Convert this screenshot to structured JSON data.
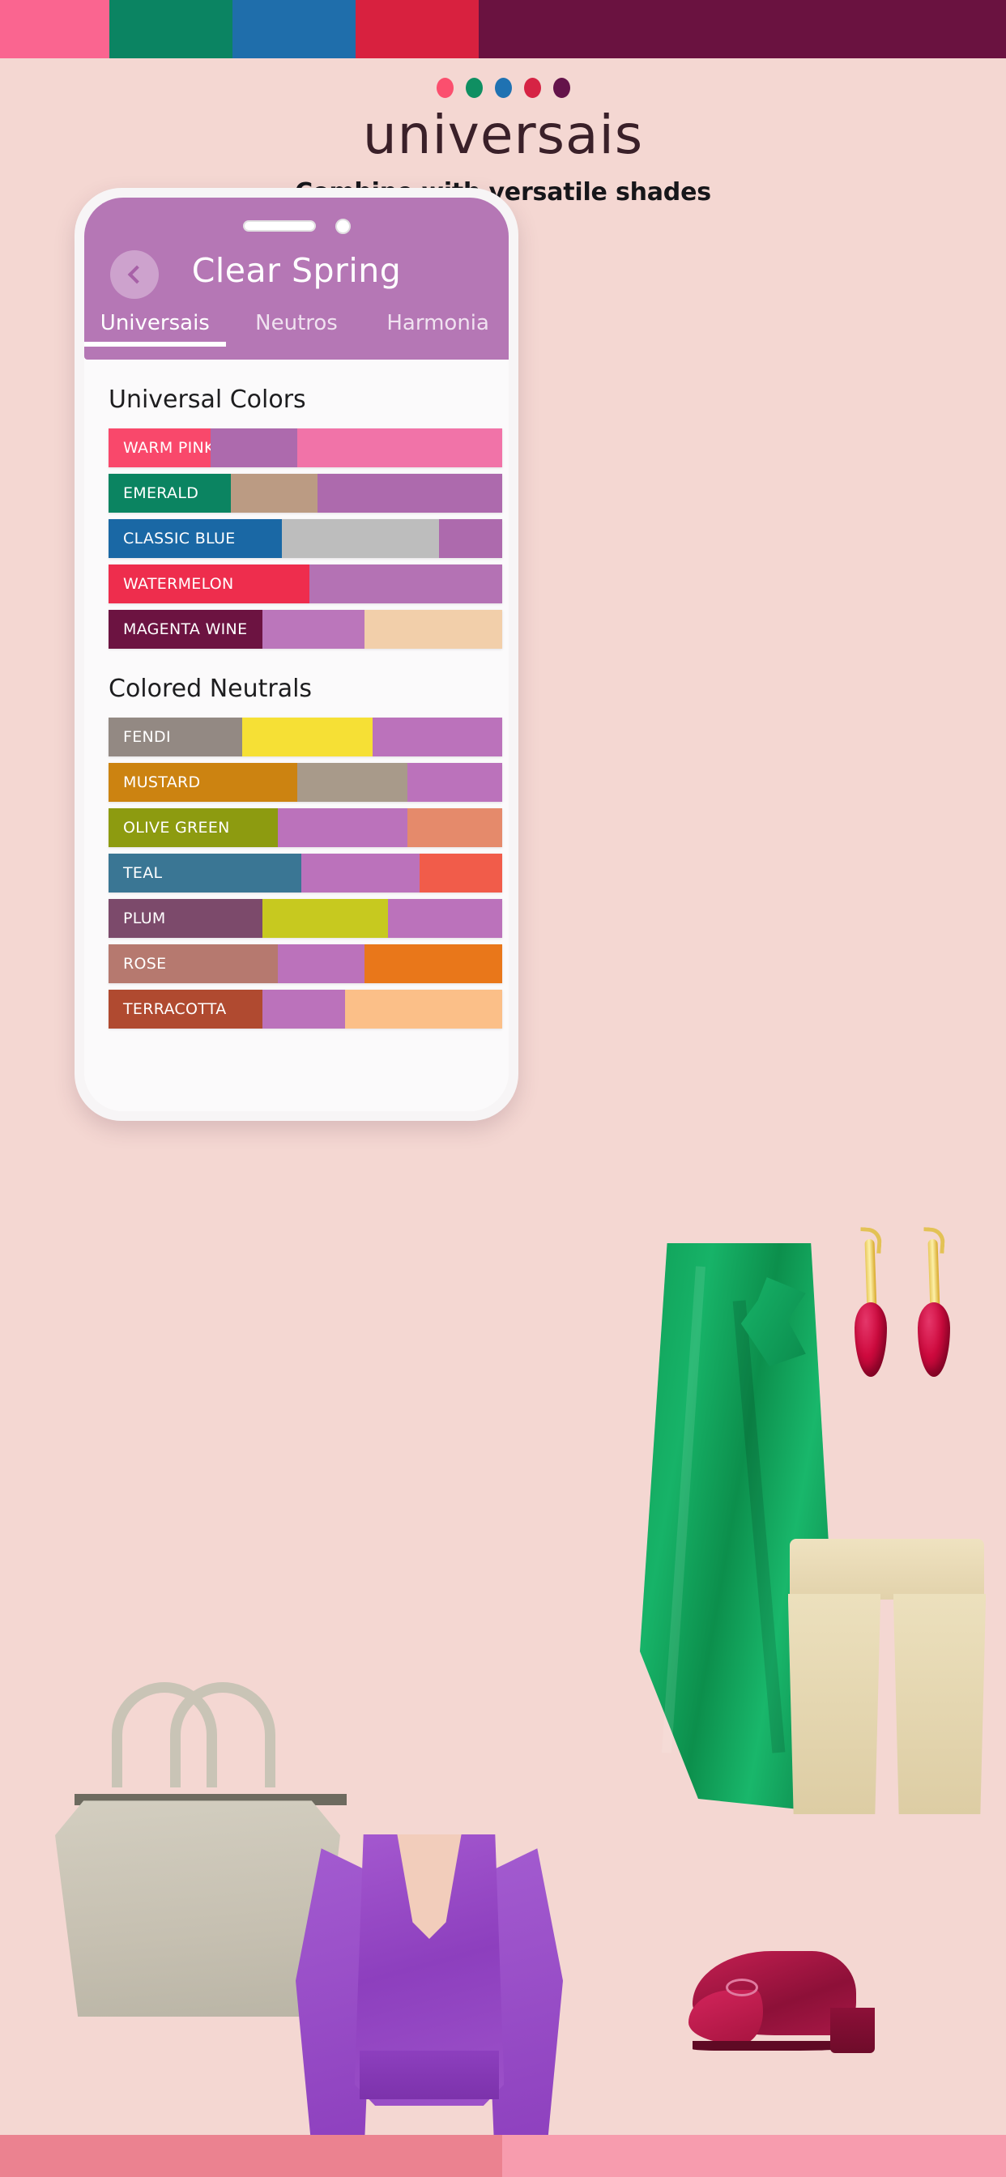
{
  "top_swatches": [
    {
      "name": "warm-pink",
      "color": "#fa6590"
    },
    {
      "name": "emerald",
      "color": "#0b8462"
    },
    {
      "name": "classic-blue",
      "color": "#1f6eab"
    },
    {
      "name": "watermelon",
      "color": "#d8213f"
    },
    {
      "name": "magenta-wine",
      "color": "#6a1240"
    }
  ],
  "brand": {
    "dots": [
      {
        "name": "dot-warm-pink",
        "color": "#fb4f6e"
      },
      {
        "name": "dot-emerald",
        "color": "#0f8f62"
      },
      {
        "name": "dot-classic-blue",
        "color": "#1f72b2"
      },
      {
        "name": "dot-watermelon",
        "color": "#d62344"
      },
      {
        "name": "dot-magenta-wine",
        "color": "#64134a"
      }
    ],
    "logo": "universais",
    "tagline": "Combine with versatile shades"
  },
  "phone": {
    "header": {
      "back_label": "‹",
      "title": "Clear Spring",
      "bg_color": "#b577b5"
    },
    "tabs": [
      {
        "label": "Universais",
        "active": true
      },
      {
        "label": "Neutros",
        "active": false
      },
      {
        "label": "Harmonia",
        "active": false
      }
    ],
    "sections": [
      {
        "title": "Universal Colors",
        "bars": [
          {
            "label": "WARM PINK",
            "segments": [
              {
                "color": "#f9486b",
                "width": 26
              },
              {
                "color": "#ad6aad",
                "width": 22
              },
              {
                "color": "#f173a8",
                "width": 52
              }
            ]
          },
          {
            "label": "EMERALD",
            "segments": [
              {
                "color": "#0b8461",
                "width": 31
              },
              {
                "color": "#bb9b83",
                "width": 22
              },
              {
                "color": "#ad6aad",
                "width": 47
              }
            ]
          },
          {
            "label": "CLASSIC BLUE",
            "segments": [
              {
                "color": "#1a68a5",
                "width": 44
              },
              {
                "color": "#bdbdbd",
                "width": 40
              },
              {
                "color": "#ad6aad",
                "width": 16
              }
            ]
          },
          {
            "label": "WATERMELON",
            "segments": [
              {
                "color": "#ee2d4d",
                "width": 51
              },
              {
                "color": "#b472b4",
                "width": 49
              }
            ]
          },
          {
            "label": "MAGENTA WINE",
            "segments": [
              {
                "color": "#6c1341",
                "width": 39
              },
              {
                "color": "#bb76bb",
                "width": 26
              },
              {
                "color": "#f2cfaa",
                "width": 35
              }
            ]
          }
        ]
      },
      {
        "title": "Colored Neutrals",
        "bars": [
          {
            "label": "FENDI",
            "segments": [
              {
                "color": "#938983",
                "width": 34
              },
              {
                "color": "#f6e035",
                "width": 33
              },
              {
                "color": "#bb72bb",
                "width": 33
              }
            ]
          },
          {
            "label": "MUSTARD",
            "segments": [
              {
                "color": "#cc8311",
                "width": 48
              },
              {
                "color": "#a89a8a",
                "width": 28
              },
              {
                "color": "#bb72bb",
                "width": 24
              }
            ]
          },
          {
            "label": "OLIVE GREEN",
            "segments": [
              {
                "color": "#8d9b10",
                "width": 43
              },
              {
                "color": "#bb72bb",
                "width": 33
              },
              {
                "color": "#e58a6b",
                "width": 24
              }
            ]
          },
          {
            "label": "TEAL",
            "segments": [
              {
                "color": "#3a7694",
                "width": 49
              },
              {
                "color": "#bb72bb",
                "width": 30
              },
              {
                "color": "#f15c4a",
                "width": 21
              }
            ]
          },
          {
            "label": "PLUM",
            "segments": [
              {
                "color": "#7c4a6b",
                "width": 39
              },
              {
                "color": "#c7c91f",
                "width": 32
              },
              {
                "color": "#bb72bb",
                "width": 29
              }
            ]
          },
          {
            "label": "ROSE",
            "segments": [
              {
                "color": "#b6796f",
                "width": 43
              },
              {
                "color": "#bb72bb",
                "width": 22
              },
              {
                "color": "#e9771a",
                "width": 35
              }
            ]
          },
          {
            "label": "TERRACOTTA",
            "segments": [
              {
                "color": "#b04a30",
                "width": 39
              },
              {
                "color": "#bb72bb",
                "width": 21
              },
              {
                "color": "#fbbf88",
                "width": 40
              }
            ]
          }
        ]
      }
    ]
  },
  "products": [
    {
      "name": "earrings",
      "description": "red gem drop earrings"
    },
    {
      "name": "skirt",
      "description": "green wrap ruffle skirt"
    },
    {
      "name": "shorts",
      "description": "beige high-waist shorts"
    },
    {
      "name": "handbag",
      "description": "taupe leather tote bag"
    },
    {
      "name": "blouse",
      "description": "purple cropped puff-sleeve blouse"
    },
    {
      "name": "shoe",
      "description": "burgundy low-heel flat"
    }
  ],
  "bottom_swatches": [
    {
      "name": "bottom-left-pink",
      "color": "#eb8290"
    },
    {
      "name": "bottom-right-pink",
      "color": "#f79cae"
    }
  ],
  "page_bg": "#f4d7d2"
}
